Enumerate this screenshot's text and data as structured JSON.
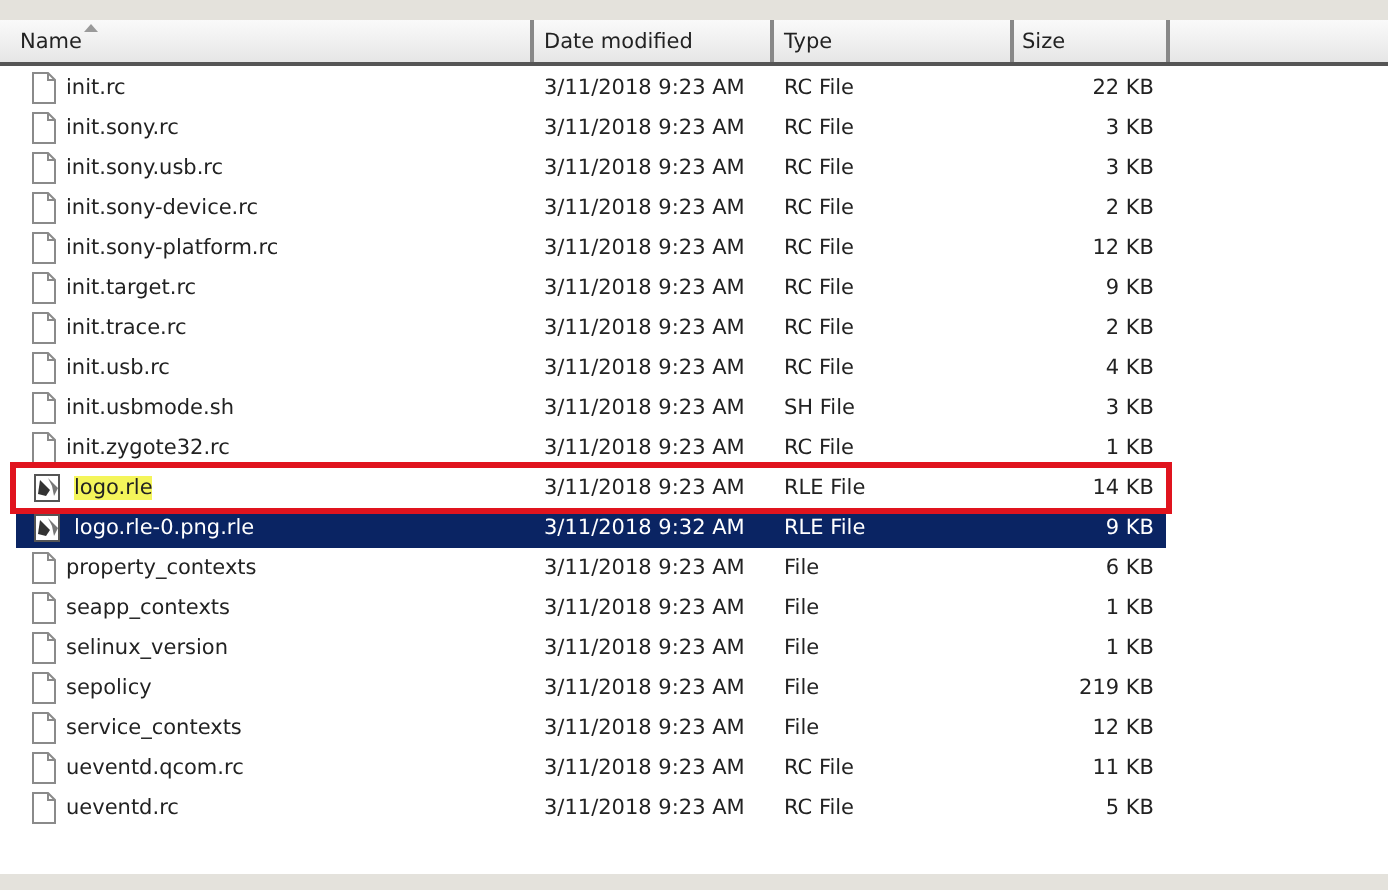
{
  "columns": [
    {
      "label": "Name",
      "sorted": true
    },
    {
      "label": "Date modified",
      "sorted": false
    },
    {
      "label": "Type",
      "sorted": false
    },
    {
      "label": "Size",
      "sorted": false
    }
  ],
  "rows": [
    {
      "name": "init.rc",
      "date": "3/11/2018 9:23 AM",
      "type": "RC File",
      "size": "22 KB",
      "kind": "doc",
      "selected": false,
      "marked": false
    },
    {
      "name": "init.sony.rc",
      "date": "3/11/2018 9:23 AM",
      "type": "RC File",
      "size": "3 KB",
      "kind": "doc",
      "selected": false,
      "marked": false
    },
    {
      "name": "init.sony.usb.rc",
      "date": "3/11/2018 9:23 AM",
      "type": "RC File",
      "size": "3 KB",
      "kind": "doc",
      "selected": false,
      "marked": false
    },
    {
      "name": "init.sony-device.rc",
      "date": "3/11/2018 9:23 AM",
      "type": "RC File",
      "size": "2 KB",
      "kind": "doc",
      "selected": false,
      "marked": false
    },
    {
      "name": "init.sony-platform.rc",
      "date": "3/11/2018 9:23 AM",
      "type": "RC File",
      "size": "12 KB",
      "kind": "doc",
      "selected": false,
      "marked": false
    },
    {
      "name": "init.target.rc",
      "date": "3/11/2018 9:23 AM",
      "type": "RC File",
      "size": "9 KB",
      "kind": "doc",
      "selected": false,
      "marked": false
    },
    {
      "name": "init.trace.rc",
      "date": "3/11/2018 9:23 AM",
      "type": "RC File",
      "size": "2 KB",
      "kind": "doc",
      "selected": false,
      "marked": false
    },
    {
      "name": "init.usb.rc",
      "date": "3/11/2018 9:23 AM",
      "type": "RC File",
      "size": "4 KB",
      "kind": "doc",
      "selected": false,
      "marked": false
    },
    {
      "name": "init.usbmode.sh",
      "date": "3/11/2018 9:23 AM",
      "type": "SH File",
      "size": "3 KB",
      "kind": "doc",
      "selected": false,
      "marked": false
    },
    {
      "name": "init.zygote32.rc",
      "date": "3/11/2018 9:23 AM",
      "type": "RC File",
      "size": "1 KB",
      "kind": "doc",
      "selected": false,
      "marked": false
    },
    {
      "name": "logo.rle",
      "date": "3/11/2018 9:23 AM",
      "type": "RLE File",
      "size": "14 KB",
      "kind": "image",
      "selected": false,
      "marked": true
    },
    {
      "name": "logo.rle-0.png.rle",
      "date": "3/11/2018 9:32 AM",
      "type": "RLE File",
      "size": "9 KB",
      "kind": "image",
      "selected": true,
      "marked": false
    },
    {
      "name": "property_contexts",
      "date": "3/11/2018 9:23 AM",
      "type": "File",
      "size": "6 KB",
      "kind": "doc",
      "selected": false,
      "marked": false
    },
    {
      "name": "seapp_contexts",
      "date": "3/11/2018 9:23 AM",
      "type": "File",
      "size": "1 KB",
      "kind": "doc",
      "selected": false,
      "marked": false
    },
    {
      "name": "selinux_version",
      "date": "3/11/2018 9:23 AM",
      "type": "File",
      "size": "1 KB",
      "kind": "doc",
      "selected": false,
      "marked": false
    },
    {
      "name": "sepolicy",
      "date": "3/11/2018 9:23 AM",
      "type": "File",
      "size": "219 KB",
      "kind": "doc",
      "selected": false,
      "marked": false
    },
    {
      "name": "service_contexts",
      "date": "3/11/2018 9:23 AM",
      "type": "File",
      "size": "12 KB",
      "kind": "doc",
      "selected": false,
      "marked": false
    },
    {
      "name": "ueventd.qcom.rc",
      "date": "3/11/2018 9:23 AM",
      "type": "RC File",
      "size": "11 KB",
      "kind": "doc",
      "selected": false,
      "marked": false
    },
    {
      "name": "ueventd.rc",
      "date": "3/11/2018 9:23 AM",
      "type": "RC File",
      "size": "5 KB",
      "kind": "doc",
      "selected": false,
      "marked": false
    }
  ]
}
